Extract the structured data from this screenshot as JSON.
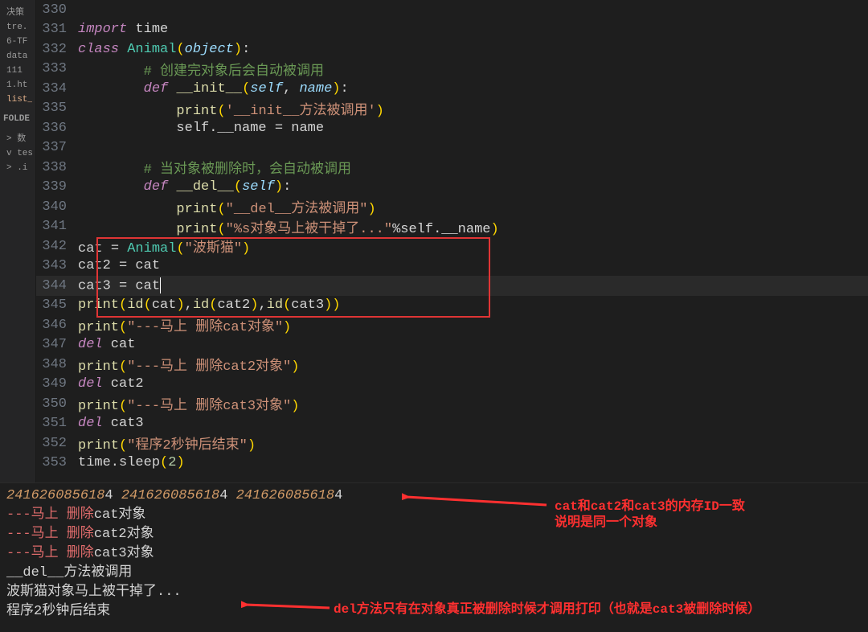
{
  "sidebar": {
    "items": [
      {
        "label": "决策"
      },
      {
        "label": "tre."
      },
      {
        "label": "6-TF"
      },
      {
        "label": "data"
      },
      {
        "label": "111"
      },
      {
        "label": "1.ht"
      },
      {
        "label": "list_"
      }
    ],
    "section": "FOLDE",
    "folders": [
      {
        "label": "数",
        "prefix": "> "
      },
      {
        "label": "tes",
        "prefix": "v "
      },
      {
        "label": ".i",
        "prefix": "> "
      }
    ]
  },
  "code": {
    "lines": [
      {
        "n": "330",
        "seg": []
      },
      {
        "n": "331",
        "seg": [
          [
            "kw",
            "import"
          ],
          [
            "op",
            " time"
          ]
        ]
      },
      {
        "n": "332",
        "seg": [
          [
            "kw",
            "class"
          ],
          [
            "op",
            " "
          ],
          [
            "cls",
            "Animal"
          ],
          [
            "pun",
            "("
          ],
          [
            "par",
            "object"
          ],
          [
            "pun",
            ")"
          ],
          [
            "op",
            ":"
          ]
        ]
      },
      {
        "n": "333",
        "seg": [
          [
            "op",
            "        "
          ],
          [
            "cmt",
            "# 创建完对象后会自动被调用"
          ]
        ]
      },
      {
        "n": "334",
        "seg": [
          [
            "op",
            "        "
          ],
          [
            "kw",
            "def"
          ],
          [
            "op",
            " "
          ],
          [
            "mag",
            "__init__"
          ],
          [
            "pun",
            "("
          ],
          [
            "self",
            "self"
          ],
          [
            "op",
            ", "
          ],
          [
            "par",
            "name"
          ],
          [
            "pun",
            ")"
          ],
          [
            "op",
            ":"
          ]
        ]
      },
      {
        "n": "335",
        "seg": [
          [
            "op",
            "            "
          ],
          [
            "fn",
            "print"
          ],
          [
            "pun",
            "("
          ],
          [
            "str",
            "'__init__方法被调用'"
          ],
          [
            "pun",
            ")"
          ]
        ]
      },
      {
        "n": "336",
        "seg": [
          [
            "op",
            "            self.__name "
          ],
          [
            "op",
            "="
          ],
          [
            "op",
            " name"
          ]
        ]
      },
      {
        "n": "337",
        "seg": []
      },
      {
        "n": "338",
        "seg": [
          [
            "op",
            "        "
          ],
          [
            "cmt",
            "# 当对象被删除时，会自动被调用"
          ]
        ]
      },
      {
        "n": "339",
        "seg": [
          [
            "op",
            "        "
          ],
          [
            "kw",
            "def"
          ],
          [
            "op",
            " "
          ],
          [
            "mag",
            "__del__"
          ],
          [
            "pun",
            "("
          ],
          [
            "self",
            "self"
          ],
          [
            "pun",
            ")"
          ],
          [
            "op",
            ":"
          ]
        ]
      },
      {
        "n": "340",
        "seg": [
          [
            "op",
            "            "
          ],
          [
            "fn",
            "print"
          ],
          [
            "pun",
            "("
          ],
          [
            "str",
            "\"__del__方法被调用\""
          ],
          [
            "pun",
            ")"
          ]
        ]
      },
      {
        "n": "341",
        "seg": [
          [
            "op",
            "            "
          ],
          [
            "fn",
            "print"
          ],
          [
            "pun",
            "("
          ],
          [
            "str",
            "\"%s对象马上被干掉了...\""
          ],
          [
            "op",
            "%self.__name"
          ],
          [
            "pun",
            ")"
          ]
        ]
      },
      {
        "n": "342",
        "seg": [
          [
            "op",
            "cat "
          ],
          [
            "op",
            "="
          ],
          [
            "op",
            " "
          ],
          [
            "cls",
            "Animal"
          ],
          [
            "pun",
            "("
          ],
          [
            "str",
            "\"波斯猫\""
          ],
          [
            "pun",
            ")"
          ]
        ]
      },
      {
        "n": "343",
        "seg": [
          [
            "op",
            "cat2 "
          ],
          [
            "op",
            "="
          ],
          [
            "op",
            " cat"
          ]
        ]
      },
      {
        "n": "344",
        "seg": [
          [
            "op",
            "cat3 "
          ],
          [
            "op",
            "="
          ],
          [
            "op",
            " cat"
          ]
        ],
        "current": true
      },
      {
        "n": "345",
        "seg": [
          [
            "fn",
            "print"
          ],
          [
            "pun",
            "("
          ],
          [
            "fn",
            "id"
          ],
          [
            "pun",
            "("
          ],
          [
            "op",
            "cat"
          ],
          [
            "pun",
            ")"
          ],
          [
            "op",
            ","
          ],
          [
            "fn",
            "id"
          ],
          [
            "pun",
            "("
          ],
          [
            "op",
            "cat2"
          ],
          [
            "pun",
            ")"
          ],
          [
            "op",
            ","
          ],
          [
            "fn",
            "id"
          ],
          [
            "pun",
            "("
          ],
          [
            "op",
            "cat3"
          ],
          [
            "pun",
            "))"
          ]
        ]
      },
      {
        "n": "346",
        "seg": [
          [
            "fn",
            "print"
          ],
          [
            "pun",
            "("
          ],
          [
            "str",
            "\"---马上 删除cat对象\""
          ],
          [
            "pun",
            ")"
          ]
        ]
      },
      {
        "n": "347",
        "seg": [
          [
            "kw",
            "del"
          ],
          [
            "op",
            " cat"
          ]
        ]
      },
      {
        "n": "348",
        "seg": [
          [
            "fn",
            "print"
          ],
          [
            "pun",
            "("
          ],
          [
            "str",
            "\"---马上 删除cat2对象\""
          ],
          [
            "pun",
            ")"
          ]
        ]
      },
      {
        "n": "349",
        "seg": [
          [
            "kw",
            "del"
          ],
          [
            "op",
            " cat2"
          ]
        ]
      },
      {
        "n": "350",
        "seg": [
          [
            "fn",
            "print"
          ],
          [
            "pun",
            "("
          ],
          [
            "str",
            "\"---马上 删除cat3对象\""
          ],
          [
            "pun",
            ")"
          ]
        ]
      },
      {
        "n": "351",
        "seg": [
          [
            "kw",
            "del"
          ],
          [
            "op",
            " cat3"
          ]
        ]
      },
      {
        "n": "352",
        "seg": [
          [
            "fn",
            "print"
          ],
          [
            "pun",
            "("
          ],
          [
            "str",
            "\"程序2秒钟后结束\""
          ],
          [
            "pun",
            ")"
          ]
        ]
      },
      {
        "n": "353",
        "seg": [
          [
            "op",
            "time.sleep"
          ],
          [
            "pun",
            "("
          ],
          [
            "num",
            "2"
          ],
          [
            "pun",
            ")"
          ]
        ]
      }
    ]
  },
  "terminal": [
    {
      "type": "ids",
      "parts": [
        [
          "term-num",
          "241626085618"
        ],
        [
          "term-txt",
          "4  "
        ],
        [
          "term-num",
          "241626085618"
        ],
        [
          "term-txt",
          "4  "
        ],
        [
          "term-num",
          "241626085618"
        ],
        [
          "term-txt",
          "4"
        ]
      ]
    },
    {
      "type": "line",
      "parts": [
        [
          "term-red",
          "---马上 删除"
        ],
        [
          "term-txt",
          "cat对象"
        ]
      ]
    },
    {
      "type": "line",
      "parts": [
        [
          "term-red",
          "---马上 删除"
        ],
        [
          "term-txt",
          "cat2对象"
        ]
      ]
    },
    {
      "type": "line",
      "parts": [
        [
          "term-red",
          "---马上 删除"
        ],
        [
          "term-txt",
          "cat3对象"
        ]
      ]
    },
    {
      "type": "line",
      "parts": [
        [
          "term-txt",
          "__del__方法被调用"
        ]
      ]
    },
    {
      "type": "line",
      "parts": [
        [
          "term-txt",
          "波斯猫对象马上被干掉了..."
        ]
      ]
    },
    {
      "type": "line",
      "parts": [
        [
          "term-txt",
          "程序2秒钟后结束"
        ]
      ]
    }
  ],
  "annotations": {
    "a1": "cat和cat2和cat3的内存ID一致\n说明是同一个对象",
    "a2": "del方法只有在对象真正被删除时候才调用打印（也就是cat3被删除时候）"
  }
}
